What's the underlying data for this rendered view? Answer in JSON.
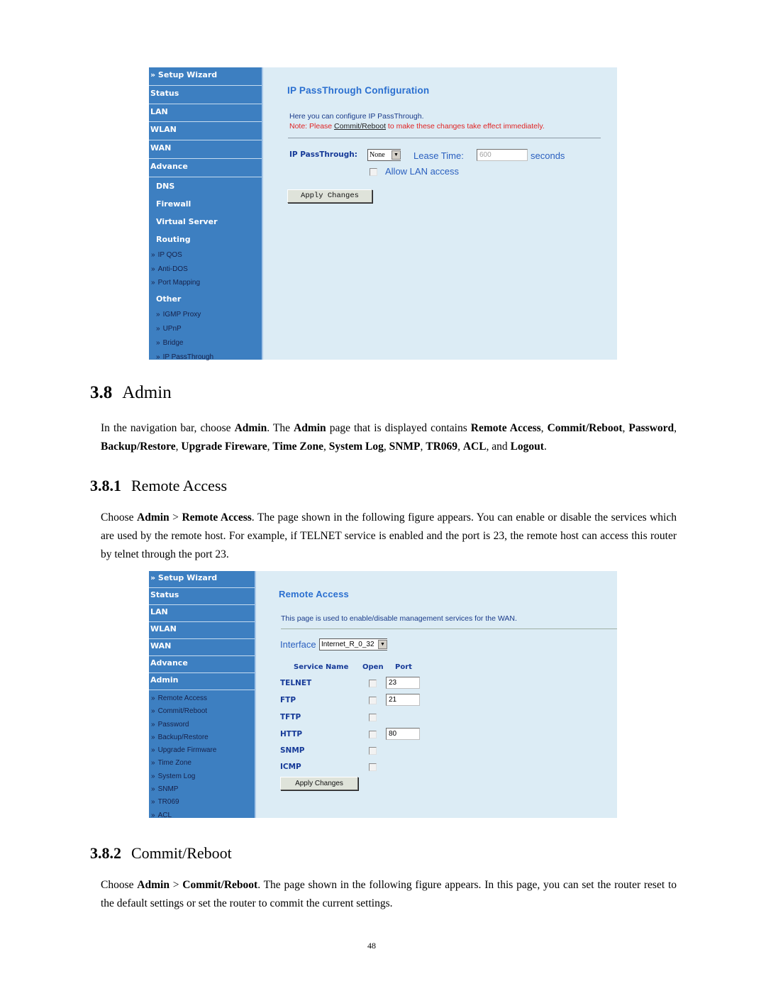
{
  "figure1": {
    "nav": {
      "top_items": [
        "» Setup Wizard",
        "Status",
        "LAN",
        "WLAN",
        "WAN",
        "Advance"
      ],
      "sub_sections": [
        {
          "label": "DNS"
        },
        {
          "label": "Firewall"
        },
        {
          "label": "Virtual Server"
        },
        {
          "label": "Routing",
          "links": [
            "IP QOS",
            "Anti-DOS",
            "Port Mapping"
          ]
        },
        {
          "label": "Other",
          "links": [
            "IGMP Proxy",
            "UPnP",
            "Bridge",
            "IP PassThrough"
          ]
        }
      ],
      "chevron": "»"
    },
    "title": "IP PassThrough Configuration",
    "description": "Here you can configure IP PassThrough.",
    "note_prefix": "Note: Please ",
    "note_link": "Commit/Reboot",
    "note_suffix": " to make these changes take effect immediately.",
    "ip_passthrough_label": "IP PassThrough:",
    "ip_passthrough_value": "None",
    "lease_time_label": "Lease Time:",
    "lease_time_value": "600",
    "lease_time_unit": "seconds",
    "allow_lan_label": "Allow LAN access",
    "allow_lan_checked": false,
    "apply_button": "Apply Changes"
  },
  "section_3_8": {
    "number": "3.8",
    "title": "Admin",
    "para": {
      "t1": "In the navigation bar, choose ",
      "b1": "Admin",
      "t2": ". The ",
      "b2": "Admin",
      "t3": " page that is displayed contains ",
      "b3": "Remote Access",
      "t4": ", ",
      "b4": "Commit/Reboot",
      "t5": ", ",
      "b5": "Password",
      "t6": ", ",
      "b6": "Backup/Restore",
      "t7": ", ",
      "b7": "Upgrade Fireware",
      "t8": ", ",
      "b8": "Time Zone",
      "t9": ", ",
      "b9": "System Log",
      "t10": ", ",
      "b10": "SNMP",
      "t11": ", ",
      "b11": "TR069",
      "t12": ", ",
      "b12": "ACL",
      "t13": ", and ",
      "b13": "Logout",
      "t14": "."
    }
  },
  "section_3_8_1": {
    "number": "3.8.1",
    "title": "Remote Access",
    "para": {
      "t1": "Choose ",
      "b1": "Admin",
      "t2": " > ",
      "b2": "Remote Access",
      "t3": ". The page shown in the following figure appears. You can enable or disable the services which are used by the remote host. For example, if TELNET service is enabled and the port is 23, the remote host can access this router by telnet through the port 23."
    }
  },
  "figure2": {
    "nav": {
      "top_items": [
        "» Setup Wizard",
        "Status",
        "LAN",
        "WLAN",
        "WAN",
        "Advance",
        "Admin"
      ],
      "links": [
        "Remote Access",
        "Commit/Reboot",
        "Password",
        "Backup/Restore",
        "Upgrade Firmware",
        "Time Zone",
        "System Log",
        "SNMP",
        "TR069",
        "ACL"
      ],
      "chevron": "»"
    },
    "title": "Remote Access",
    "description": "This page is used to enable/disable management services for the WAN.",
    "interface_label": "Interface",
    "interface_value": "Internet_R_0_32",
    "columns": [
      "Service Name",
      "Open",
      "Port"
    ],
    "services": [
      {
        "name": "TELNET",
        "open": false,
        "port": "23"
      },
      {
        "name": "FTP",
        "open": false,
        "port": "21"
      },
      {
        "name": "TFTP",
        "open": false,
        "port": null
      },
      {
        "name": "HTTP",
        "open": false,
        "port": "80"
      },
      {
        "name": "SNMP",
        "open": false,
        "port": null
      },
      {
        "name": "ICMP",
        "open": false,
        "port": null
      }
    ],
    "apply_button": "Apply Changes"
  },
  "section_3_8_2": {
    "number": "3.8.2",
    "title": "Commit/Reboot",
    "para": {
      "t1": "Choose ",
      "b1": "Admin",
      "t2": " > ",
      "b2": "Commit/Reboot",
      "t3": ". The page shown in the following figure appears. In this page, you can set the router reset to the default settings or set the router to commit the current settings."
    }
  },
  "page_number": "48"
}
